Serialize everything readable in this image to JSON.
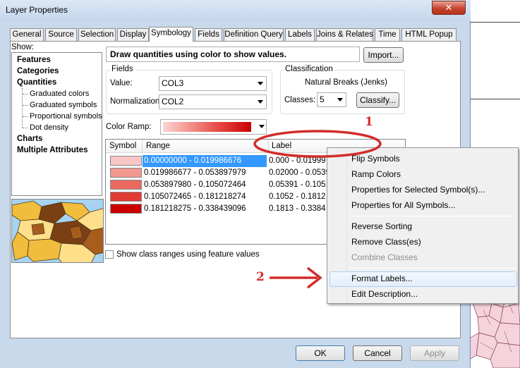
{
  "window": {
    "title": "Layer Properties",
    "close_glyph": "✕"
  },
  "tabs": [
    "General",
    "Source",
    "Selection",
    "Display",
    "Symbology",
    "Fields",
    "Definition Query",
    "Labels",
    "Joins & Relates",
    "Time",
    "HTML Popup"
  ],
  "active_tab": "Symbology",
  "show_panel": {
    "label": "Show:",
    "items": [
      {
        "label": "Features",
        "bold": true,
        "indent": 0
      },
      {
        "label": "Categories",
        "bold": true,
        "indent": 0
      },
      {
        "label": "Quantities",
        "bold": true,
        "indent": 0
      },
      {
        "label": "Graduated colors",
        "bold": false,
        "indent": 1
      },
      {
        "label": "Graduated symbols",
        "bold": false,
        "indent": 1
      },
      {
        "label": "Proportional symbols",
        "bold": false,
        "indent": 1
      },
      {
        "label": "Dot density",
        "bold": false,
        "indent": 1
      },
      {
        "label": "Charts",
        "bold": true,
        "indent": 0
      },
      {
        "label": "Multiple Attributes",
        "bold": true,
        "indent": 0
      }
    ]
  },
  "description": "Draw quantities using color to show values.",
  "import_button": "Import...",
  "fields": {
    "group_label": "Fields",
    "value_label": "Value:",
    "value": "COL3",
    "normalization_label": "Normalization:",
    "normalization": "COL2"
  },
  "classification": {
    "group_label": "Classification",
    "method": "Natural Breaks (Jenks)",
    "classes_label": "Classes:",
    "classes": "5",
    "classify_button": "Classify..."
  },
  "color_ramp_label": "Color Ramp:",
  "table": {
    "headers": {
      "symbol": "Symbol",
      "range": "Range",
      "label": "Label"
    },
    "rows": [
      {
        "color": "#f8c6c4",
        "range": "0.00000000 - 0.019986676",
        "label": "0.000 - 0.01999",
        "selected": true
      },
      {
        "color": "#f19891",
        "range": "0.019986677 - 0.053897979",
        "label": "0.02000 - 0.05390",
        "selected": false
      },
      {
        "color": "#ea6a5f",
        "range": "0.053897980 - 0.105072464",
        "label": "0.05391 - 0.1051",
        "selected": false
      },
      {
        "color": "#e03c34",
        "range": "0.105072465 - 0.181218274",
        "label": "0.1052 - 0.1812",
        "selected": false
      },
      {
        "color": "#cc0000",
        "range": "0.181218275 - 0.338439096",
        "label": "0.1813 - 0.3384",
        "selected": false
      }
    ]
  },
  "show_class_ranges": {
    "label": "Show class ranges using feature values",
    "checked": false
  },
  "context_menu": {
    "items": [
      {
        "label": "Flip Symbols",
        "disabled": false
      },
      {
        "label": "Ramp Colors",
        "disabled": false
      },
      {
        "label": "Properties for Selected Symbol(s)...",
        "disabled": false
      },
      {
        "label": "Properties for All Symbols...",
        "disabled": false
      },
      {
        "label": "Reverse Sorting",
        "disabled": false
      },
      {
        "label": "Remove Class(es)",
        "disabled": false
      },
      {
        "label": "Combine Classes",
        "disabled": true
      },
      {
        "label": "Format Labels...",
        "disabled": false,
        "highlighted": true
      },
      {
        "label": "Edit Description...",
        "disabled": false
      }
    ]
  },
  "footer": {
    "ok": "OK",
    "cancel": "Cancel",
    "apply": "Apply"
  },
  "annotations": {
    "one": "1",
    "two": "2",
    "color": "#d22c2c"
  }
}
